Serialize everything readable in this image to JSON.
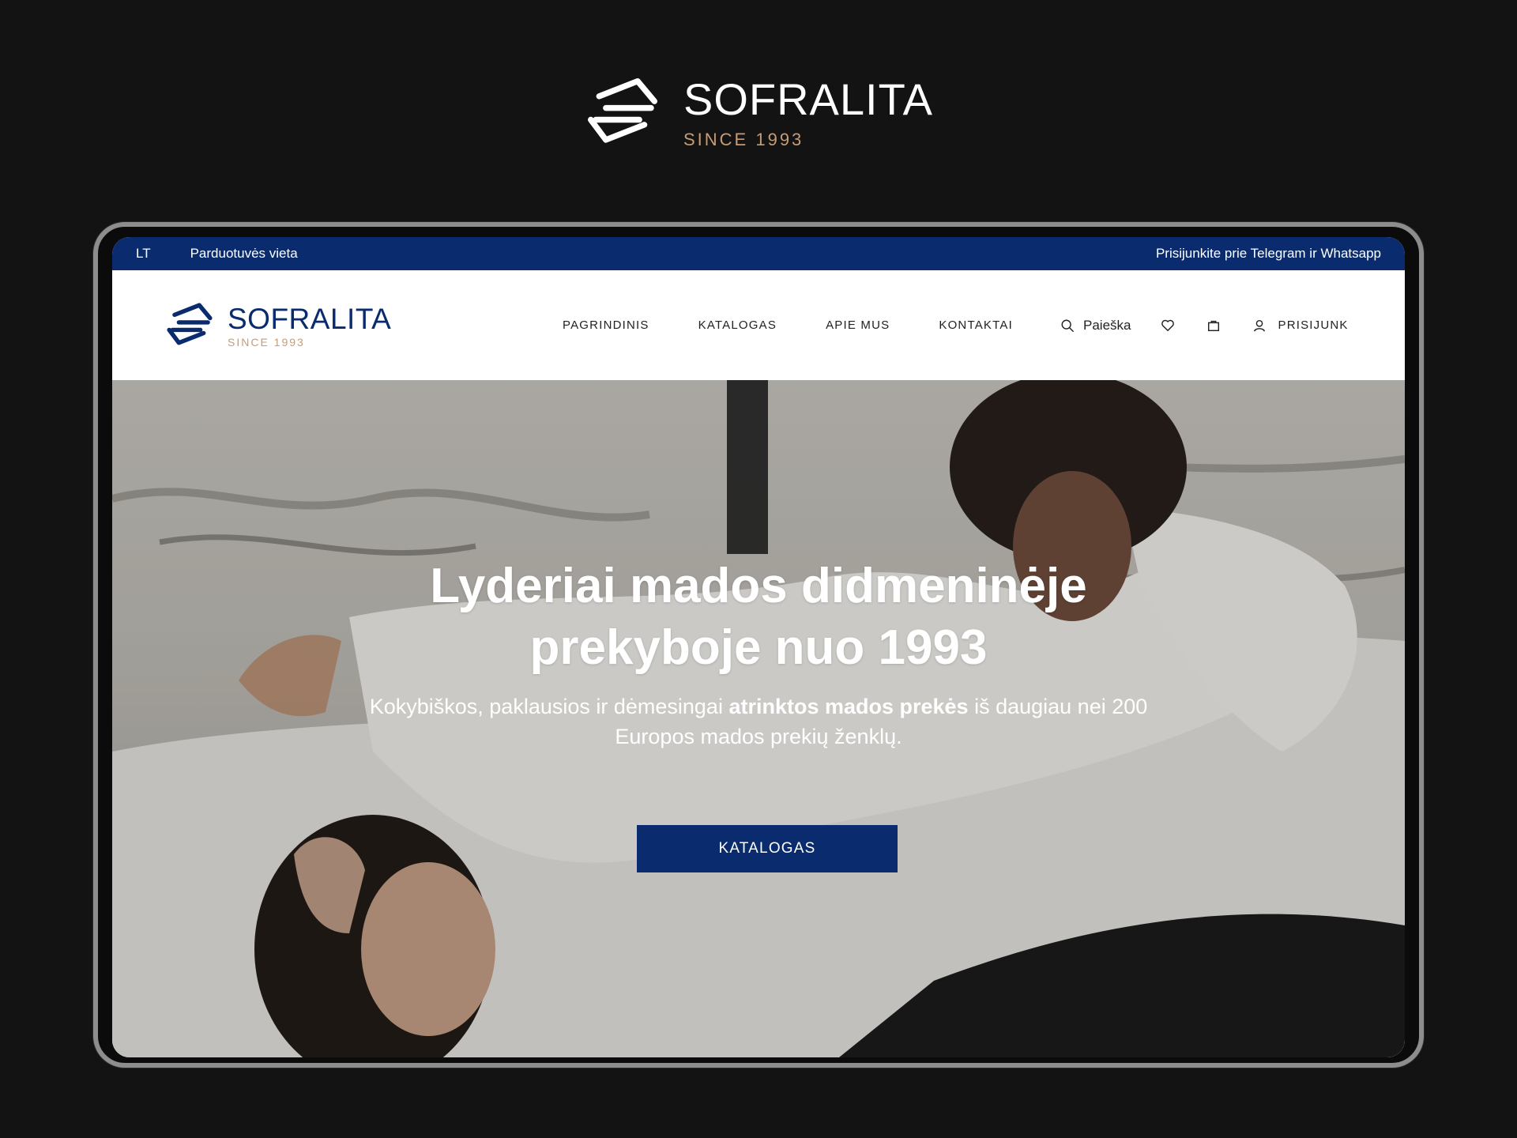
{
  "brand": {
    "name": "SOFRALITA",
    "since": "SINCE 1993"
  },
  "topbar": {
    "lang": "LT",
    "store": "Parduotuvės vieta",
    "social": "Prisijunkite prie Telegram ir Whatsapp"
  },
  "nav": {
    "items": [
      "PAGRINDINIS",
      "KATALOGAS",
      "APIE MUS",
      "KONTAKTAI"
    ]
  },
  "tools": {
    "search_label": "Paieška",
    "account_label": "PRISIJUNK"
  },
  "hero": {
    "title_line1": "Lyderiai mados didmeninėje",
    "title_line2": "prekyboje nuo 1993",
    "sub_part1": "Kokybiškos, paklausios ir dėmesingai ",
    "sub_bold": "atrinktos mados prekės",
    "sub_part2": " iš daugiau nei 200 Europos mados prekių ženklų.",
    "cta": "KATALOGAS"
  },
  "colors": {
    "background": "#131313",
    "brand_navy": "#0a2c6e",
    "accent_gold": "#c79c75",
    "frame": "#8d8d8d"
  },
  "icons": [
    "logo-mark",
    "search-icon",
    "heart-icon",
    "bag-icon",
    "user-icon"
  ]
}
